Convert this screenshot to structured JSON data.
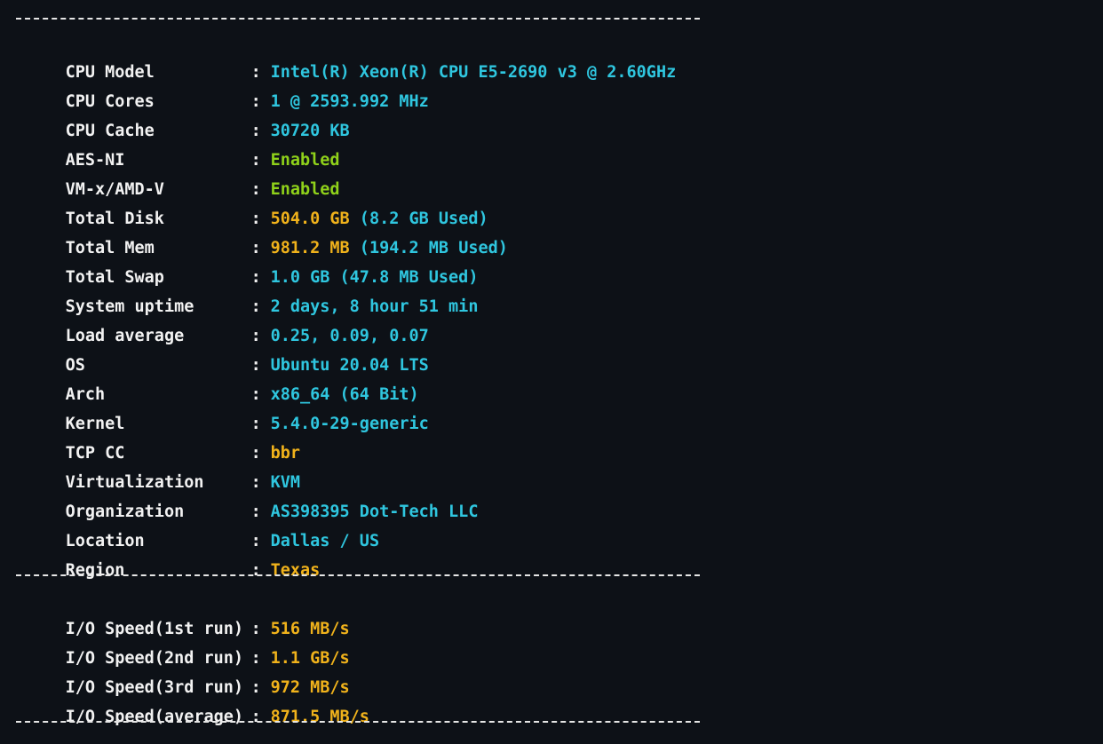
{
  "colors": {
    "background": "#0d1117",
    "label": "#f2f2f2",
    "cyan": "#2fc6df",
    "green": "#8fd11a",
    "yellow": "#f0b21b",
    "separator": "#e6e6e6"
  },
  "separator_char": "-",
  "colon": ":",
  "system_info": [
    {
      "label": "CPU Model",
      "segments": [
        {
          "text": "Intel(R) Xeon(R) CPU E5-2690 v3 @ 2.60GHz",
          "color": "cyan"
        }
      ]
    },
    {
      "label": "CPU Cores",
      "segments": [
        {
          "text": "1 @ 2593.992 MHz",
          "color": "cyan"
        }
      ]
    },
    {
      "label": "CPU Cache",
      "segments": [
        {
          "text": "30720 KB",
          "color": "cyan"
        }
      ]
    },
    {
      "label": "AES-NI",
      "segments": [
        {
          "text": "Enabled",
          "color": "green"
        }
      ]
    },
    {
      "label": "VM-x/AMD-V",
      "segments": [
        {
          "text": "Enabled",
          "color": "green"
        }
      ]
    },
    {
      "label": "Total Disk",
      "segments": [
        {
          "text": "504.0 GB",
          "color": "yellow"
        },
        {
          "text": " (8.2 GB Used)",
          "color": "cyan"
        }
      ]
    },
    {
      "label": "Total Mem",
      "segments": [
        {
          "text": "981.2 MB",
          "color": "yellow"
        },
        {
          "text": " (194.2 MB Used)",
          "color": "cyan"
        }
      ]
    },
    {
      "label": "Total Swap",
      "segments": [
        {
          "text": "1.0 GB (47.8 MB Used)",
          "color": "cyan"
        }
      ]
    },
    {
      "label": "System uptime",
      "segments": [
        {
          "text": "2 days, 8 hour 51 min",
          "color": "cyan"
        }
      ]
    },
    {
      "label": "Load average",
      "segments": [
        {
          "text": "0.25, 0.09, 0.07",
          "color": "cyan"
        }
      ]
    },
    {
      "label": "OS",
      "segments": [
        {
          "text": "Ubuntu 20.04 LTS",
          "color": "cyan"
        }
      ]
    },
    {
      "label": "Arch",
      "segments": [
        {
          "text": "x86_64 (64 Bit)",
          "color": "cyan"
        }
      ]
    },
    {
      "label": "Kernel",
      "segments": [
        {
          "text": "5.4.0-29-generic",
          "color": "cyan"
        }
      ]
    },
    {
      "label": "TCP CC",
      "segments": [
        {
          "text": "bbr",
          "color": "yellow"
        }
      ]
    },
    {
      "label": "Virtualization",
      "segments": [
        {
          "text": "KVM",
          "color": "cyan"
        }
      ]
    },
    {
      "label": "Organization",
      "segments": [
        {
          "text": "AS398395 Dot-Tech LLC",
          "color": "cyan"
        }
      ]
    },
    {
      "label": "Location",
      "segments": [
        {
          "text": "Dallas / US",
          "color": "cyan"
        }
      ]
    },
    {
      "label": "Region",
      "segments": [
        {
          "text": "Texas",
          "color": "yellow"
        }
      ]
    }
  ],
  "io_speed": [
    {
      "label": "I/O Speed(1st run)",
      "value": "516 MB/s"
    },
    {
      "label": "I/O Speed(2nd run)",
      "value": "1.1 GB/s"
    },
    {
      "label": "I/O Speed(3rd run)",
      "value": "972 MB/s"
    },
    {
      "label": "I/O Speed(average)",
      "value": "871.5 MB/s"
    }
  ]
}
